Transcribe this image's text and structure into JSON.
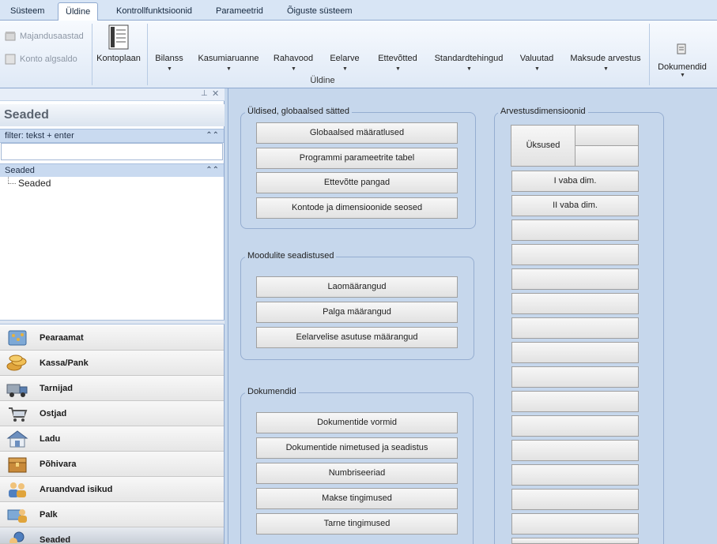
{
  "tabs": [
    "Süsteem",
    "Üldine",
    "Kontrollfunktsioonid",
    "Parameetrid",
    "Õiguste süsteem"
  ],
  "ribbon": {
    "small_buttons": [
      "Majandusaastad",
      "Konto algsaldo"
    ],
    "kontoplaan": "Kontoplaan",
    "items": [
      "Bilanss",
      "Kasumiaruanne",
      "Rahavood",
      "Eelarve",
      "Ettevõtted",
      "Standardtehingud",
      "Valuutad",
      "Maksude arvestus"
    ],
    "group_label": "Üldine",
    "dokumendid": "Dokumendid"
  },
  "left": {
    "title": "Seaded",
    "filter_label": "filter: tekst + enter",
    "filter_value": "",
    "tree_header": "Seaded",
    "tree_item": "Seaded",
    "nav": [
      "Pearaamat",
      "Kassa/Pank",
      "Tarnijad",
      "Ostjad",
      "Ladu",
      "Põhivara",
      "Aruandvad isikud",
      "Palk",
      "Seaded"
    ]
  },
  "groups": {
    "yldised": {
      "title": "Üldised, globaalsed sätted",
      "buttons": [
        "Globaalsed määratlused",
        "Programmi parameetrite tabel",
        "Ettevõtte pangad",
        "Kontode ja dimensioonide seosed"
      ]
    },
    "moodulid": {
      "title": "Moodulite seadistused",
      "buttons": [
        "Laomäärangud",
        "Palga määrangud",
        "Eelarvelise asutuse määrangud"
      ]
    },
    "dokumendid": {
      "title": "Dokumendid",
      "buttons": [
        "Dokumentide vormid",
        "Dokumentide nimetused ja seadistus",
        "Numbriseeriad",
        "Makse tingimused",
        "Tarne tingimused"
      ]
    },
    "arvestus": {
      "title": "Arvestusdimensioonid",
      "uksused": "Üksused",
      "dims": [
        "I vaba dim.",
        "II vaba dim."
      ]
    }
  },
  "colors": {
    "accent": "#c6d7ec",
    "tab_border": "#8fa9cf"
  }
}
